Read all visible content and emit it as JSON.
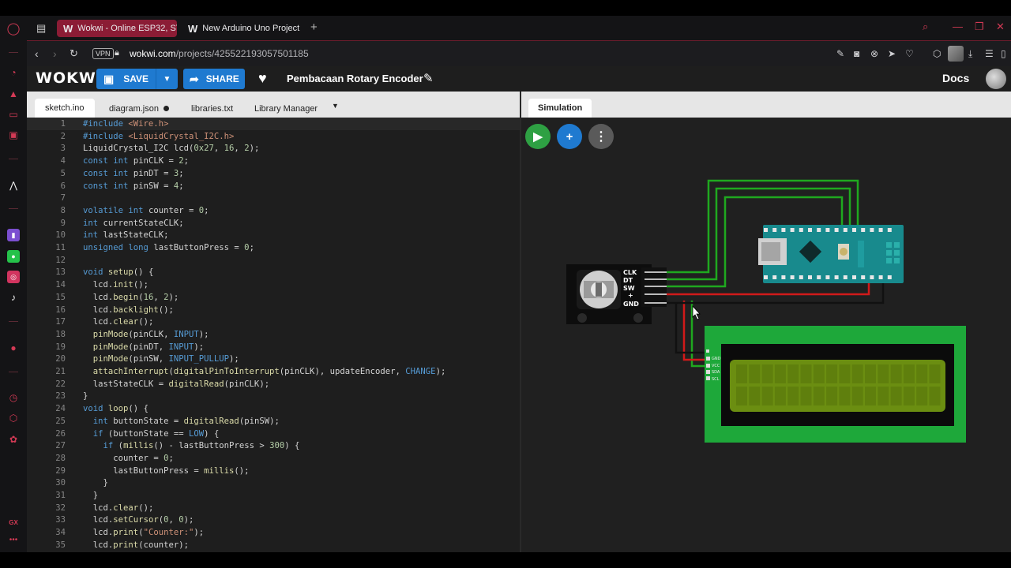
{
  "browser": {
    "tabs": [
      {
        "label": "Wokwi - Online ESP32, ST",
        "active": true
      },
      {
        "label": "New Arduino Uno Project",
        "active": false
      }
    ],
    "url_domain": "wokwi.com",
    "url_path": "/projects/425522193057501185",
    "vpn_label": "VPN",
    "accent": "#8b1c35"
  },
  "header": {
    "logo": "WOKWI",
    "save_label": "SAVE",
    "share_label": "SHARE",
    "project_title": "Pembacaan Rotary Encoder",
    "docs_label": "Docs",
    "button_color": "#1f7ad0"
  },
  "editor": {
    "tabs": [
      {
        "label": "sketch.ino",
        "active": true
      },
      {
        "label": "diagram.json",
        "modified": true
      },
      {
        "label": "libraries.txt"
      },
      {
        "label": "Library Manager"
      }
    ],
    "lines": [
      "#include <Wire.h>",
      "#include <LiquidCrystal_I2C.h>",
      "LiquidCrystal_I2C lcd(0x27, 16, 2);",
      "const int pinCLK = 2;",
      "const int pinDT = 3;",
      "const int pinSW = 4;",
      "",
      "volatile int counter = 0;",
      "int currentStateCLK;",
      "int lastStateCLK;",
      "unsigned long lastButtonPress = 0;",
      "",
      "void setup() {",
      "  lcd.init();",
      "  lcd.begin(16, 2);",
      "  lcd.backlight();",
      "  lcd.clear();",
      "  pinMode(pinCLK, INPUT);",
      "  pinMode(pinDT, INPUT);",
      "  pinMode(pinSW, INPUT_PULLUP);",
      "  attachInterrupt(digitalPinToInterrupt(pinCLK), updateEncoder, CHANGE);",
      "  lastStateCLK = digitalRead(pinCLK);",
      "}",
      "void loop() {",
      "  int buttonState = digitalRead(pinSW);",
      "  if (buttonState == LOW) {",
      "    if (millis() - lastButtonPress > 300) {",
      "      counter = 0;",
      "      lastButtonPress = millis();",
      "    }",
      "  }",
      "  lcd.clear();",
      "  lcd.setCursor(0, 0);",
      "  lcd.print(\"Counter:\");",
      "  lcd.print(counter);"
    ]
  },
  "simulation": {
    "tab_label": "Simulation",
    "encoder_pins": [
      "CLK",
      "DT",
      "SW",
      "+",
      "GND"
    ],
    "lcd_pins": [
      "GND",
      "VCC",
      "SDA",
      "SCL"
    ],
    "wire_colors": {
      "signal": "#1fa81f",
      "power": "#d11a1a",
      "ground": "#111111"
    },
    "lcd_pcb_color": "#1ea83a",
    "lcd_screen_color": "#6b8e11",
    "nano_color": "#188a8d"
  },
  "sidebar_icons": [
    "opera-logo-icon",
    "aria-icon",
    "bag-icon",
    "chat-icon",
    "music-icon",
    "crypto-icon",
    "twitch-icon",
    "whatsapp-icon",
    "instagram-icon",
    "tiktok-icon",
    "player-icon",
    "history-icon",
    "extensions-icon",
    "settings-icon",
    "gx-icon",
    "more-icon"
  ]
}
